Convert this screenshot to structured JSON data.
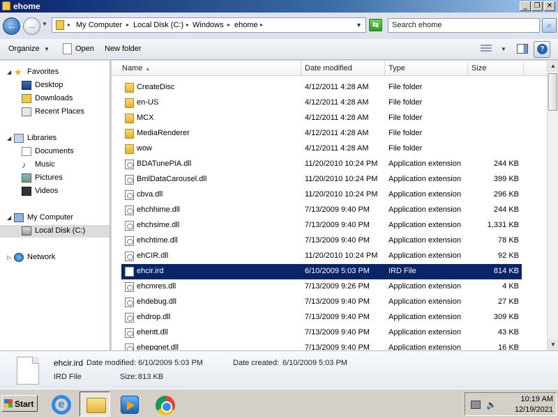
{
  "window": {
    "title": "ehome"
  },
  "address": {
    "crumbs": [
      "My Computer",
      "Local Disk (C:)",
      "Windows",
      "ehome"
    ],
    "search_placeholder": "Search ehome"
  },
  "toolbar": {
    "organize": "Organize",
    "open": "Open",
    "new_folder": "New folder"
  },
  "nav": {
    "favorites": "Favorites",
    "desktop": "Desktop",
    "downloads": "Downloads",
    "recent": "Recent Places",
    "libraries": "Libraries",
    "documents": "Documents",
    "music": "Music",
    "pictures": "Pictures",
    "videos": "Videos",
    "computer": "My Computer",
    "localdisk": "Local Disk (C:)",
    "network": "Network"
  },
  "columns": {
    "name": "Name",
    "date": "Date modified",
    "type": "Type",
    "size": "Size"
  },
  "files": [
    {
      "name": "CreateDisc",
      "date": "4/12/2011 4:28 AM",
      "type": "File folder",
      "size": "",
      "kind": "folder"
    },
    {
      "name": "en-US",
      "date": "4/12/2011 4:28 AM",
      "type": "File folder",
      "size": "",
      "kind": "folder"
    },
    {
      "name": "MCX",
      "date": "4/12/2011 4:28 AM",
      "type": "File folder",
      "size": "",
      "kind": "folder"
    },
    {
      "name": "MediaRenderer",
      "date": "4/12/2011 4:28 AM",
      "type": "File folder",
      "size": "",
      "kind": "folder"
    },
    {
      "name": "wow",
      "date": "4/12/2011 4:28 AM",
      "type": "File folder",
      "size": "",
      "kind": "folder"
    },
    {
      "name": "BDATunePIA.dll",
      "date": "11/20/2010 10:24 PM",
      "type": "Application extension",
      "size": "244 KB",
      "kind": "dll"
    },
    {
      "name": "BmlDataCarousel.dll",
      "date": "11/20/2010 10:24 PM",
      "type": "Application extension",
      "size": "399 KB",
      "kind": "dll"
    },
    {
      "name": "cbva.dll",
      "date": "11/20/2010 10:24 PM",
      "type": "Application extension",
      "size": "296 KB",
      "kind": "dll"
    },
    {
      "name": "ehchhime.dll",
      "date": "7/13/2009 9:40 PM",
      "type": "Application extension",
      "size": "244 KB",
      "kind": "dll"
    },
    {
      "name": "ehchsime.dll",
      "date": "7/13/2009 9:40 PM",
      "type": "Application extension",
      "size": "1,331 KB",
      "kind": "dll"
    },
    {
      "name": "ehchtime.dll",
      "date": "7/13/2009 9:40 PM",
      "type": "Application extension",
      "size": "78 KB",
      "kind": "dll"
    },
    {
      "name": "ehCIR.dll",
      "date": "11/20/2010 10:24 PM",
      "type": "Application extension",
      "size": "92 KB",
      "kind": "dll"
    },
    {
      "name": "ehcir.ird",
      "date": "6/10/2009 5:03 PM",
      "type": "IRD File",
      "size": "814 KB",
      "kind": "ird",
      "selected": true
    },
    {
      "name": "ehcmres.dll",
      "date": "7/13/2009 9:26 PM",
      "type": "Application extension",
      "size": "4 KB",
      "kind": "dll"
    },
    {
      "name": "ehdebug.dll",
      "date": "7/13/2009 9:40 PM",
      "type": "Application extension",
      "size": "27 KB",
      "kind": "dll"
    },
    {
      "name": "ehdrop.dll",
      "date": "7/13/2009 9:40 PM",
      "type": "Application extension",
      "size": "309 KB",
      "kind": "dll"
    },
    {
      "name": "ehentt.dll",
      "date": "7/13/2009 9:40 PM",
      "type": "Application extension",
      "size": "43 KB",
      "kind": "dll"
    },
    {
      "name": "ehepgnet.dll",
      "date": "7/13/2009 9:40 PM",
      "type": "Application extension",
      "size": "16 KB",
      "kind": "dll"
    }
  ],
  "details": {
    "name": "ehcir.ird",
    "type": "IRD File",
    "modified_label": "Date modified:",
    "modified": "6/10/2009 5:03 PM",
    "created_label": "Date created:",
    "created": "6/10/2009 5:03 PM",
    "size_label": "Size:",
    "size": "813 KB"
  },
  "taskbar": {
    "start": "Start",
    "time": "10:19 AM",
    "date": "12/19/2021"
  },
  "colors": {
    "selection": "#0a246a",
    "title_bar": "#0a246a",
    "folder": "#f1c850"
  }
}
